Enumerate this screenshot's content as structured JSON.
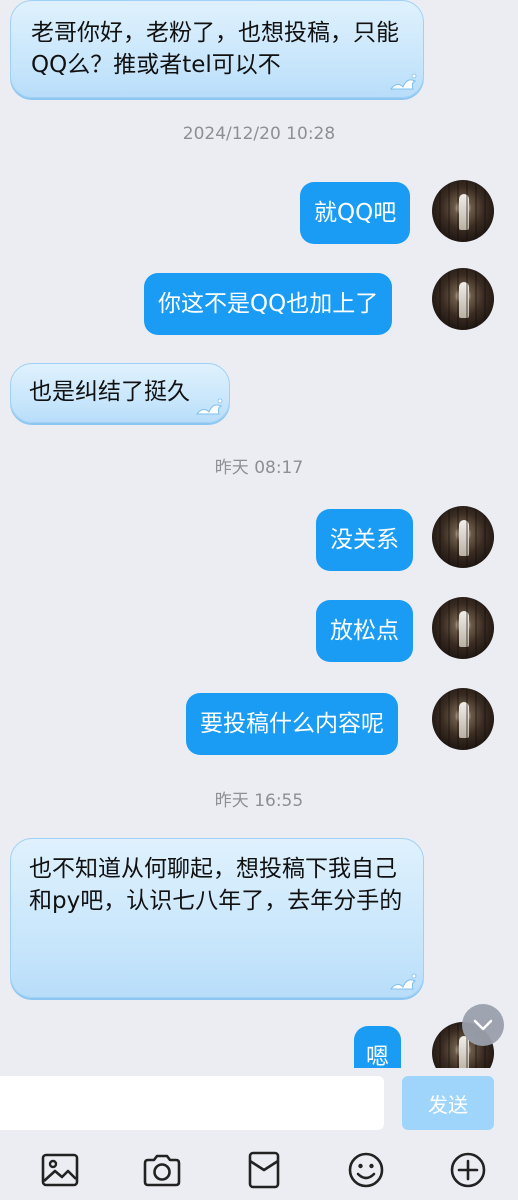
{
  "messages": {
    "m1": "老哥你好，老粉了，也想投稿，只能QQ么？推或者tel可以不",
    "t1": "2024/12/20 10:28",
    "m2": "就QQ吧",
    "m3": "你这不是QQ也加上了",
    "m4": "也是纠结了挺久",
    "t2": "昨天 08:17",
    "m5": "没关系",
    "m6": "放松点",
    "m7": "要投稿什么内容呢",
    "t3": "昨天 16:55",
    "m8": "也不知道从何聊起，想投稿下我自己和py吧，认识七八年了，去年分手的",
    "m9": "嗯"
  },
  "input": {
    "value": "",
    "send_label": "发送"
  },
  "toolbar": {
    "icons": [
      "image-icon",
      "camera-icon",
      "red-packet-icon",
      "emoji-icon",
      "plus-icon"
    ]
  },
  "colors": {
    "background": "#ecedf3",
    "sent_bubble": "#1a9cf5",
    "received_bubble": "#c6e5fb",
    "send_button": "#9fd5fb",
    "timestamp": "#8e8f94"
  }
}
